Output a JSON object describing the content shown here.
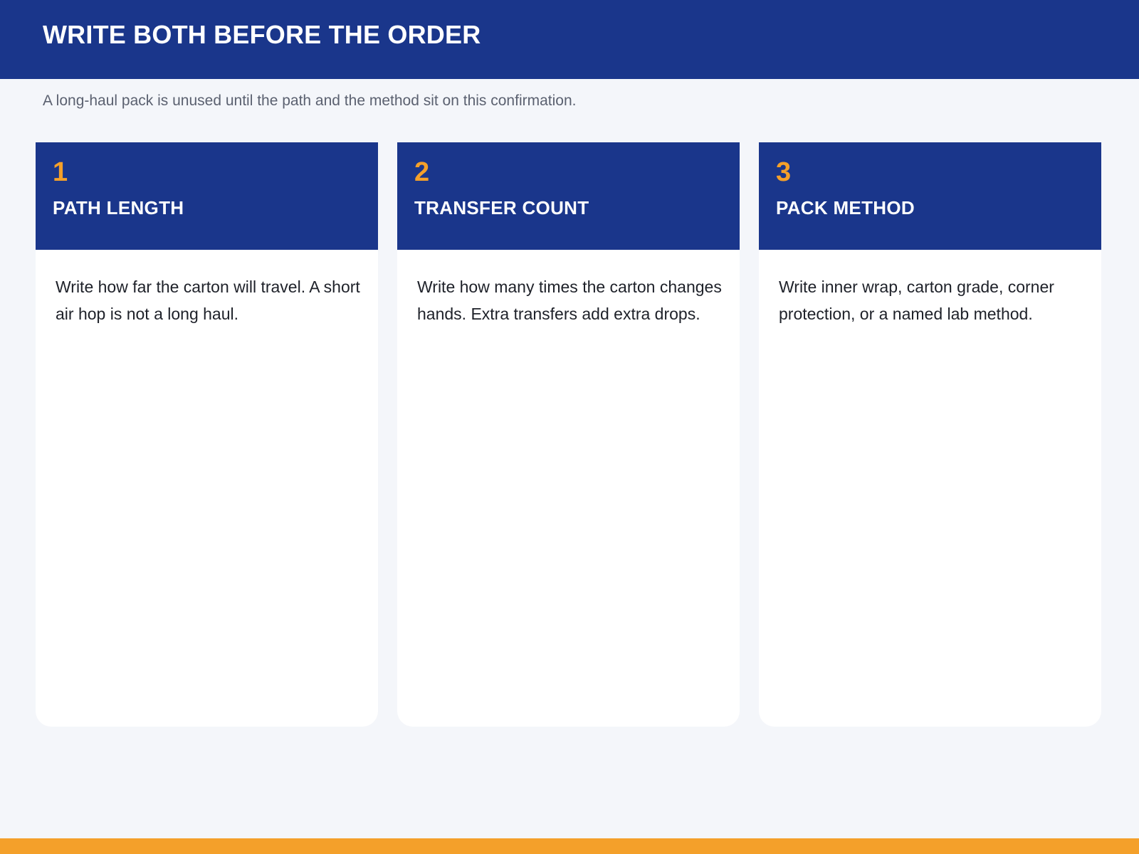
{
  "header": {
    "title": "WRITE BOTH BEFORE THE ORDER"
  },
  "subtitle": "A long-haul pack is unused until the path and the method sit on this confirmation.",
  "cards": [
    {
      "number": "1",
      "title": "PATH LENGTH",
      "body": "Write how far the carton will travel. A short air hop is not a long haul."
    },
    {
      "number": "2",
      "title": "TRANSFER COUNT",
      "body": "Write how many times the carton changes hands. Extra transfers add extra drops."
    },
    {
      "number": "3",
      "title": "PACK METHOD",
      "body": "Write inner wrap, carton grade, corner protection, or a named lab method."
    }
  ],
  "colors": {
    "header_bg": "#1a368b",
    "accent": "#f4a02a",
    "page_bg": "#f4f6fa",
    "card_bg": "#ffffff"
  }
}
